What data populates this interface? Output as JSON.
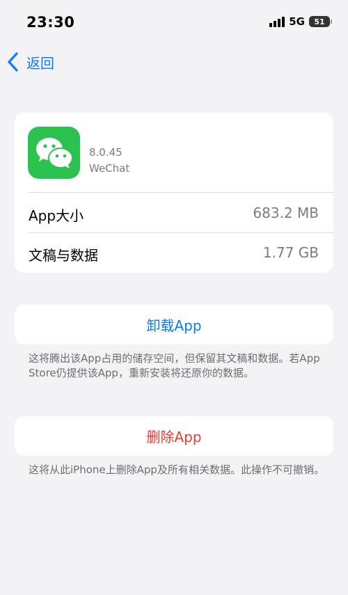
{
  "status_bar": {
    "time": "23:30",
    "network": "5G",
    "battery": "51"
  },
  "nav": {
    "back_label": "返回"
  },
  "app": {
    "version": "8.0.45",
    "name": "WeChat",
    "icon": "wechat-icon"
  },
  "rows": [
    {
      "label": "App大小",
      "value": "683.2 MB"
    },
    {
      "label": "文稿与数据",
      "value": "1.77 GB"
    }
  ],
  "offload": {
    "label": "卸载App",
    "note": "这将腾出该App占用的储存空间，但保留其文稿和数据。若App Store仍提供该App，重新安装将还原你的数据。"
  },
  "delete": {
    "label": "删除App",
    "note": "这将从此iPhone上删除App及所有相关数据。此操作不可撤销。"
  },
  "colors": {
    "accent": "#0a7aff",
    "destructive": "#eb3b30",
    "wechat_green": "#2bc24f",
    "background": "#f2f2f7"
  }
}
